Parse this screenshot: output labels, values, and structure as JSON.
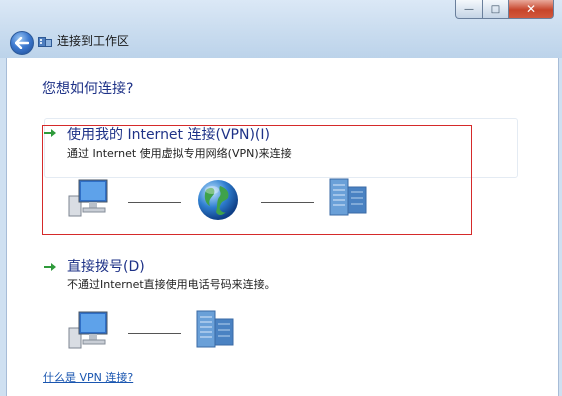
{
  "header": {
    "title": "连接到工作区",
    "minimize_label": "—",
    "maximize_label": "□",
    "close_label": "✕"
  },
  "main": {
    "question": "您想如何连接?",
    "options": [
      {
        "title": "使用我的 Internet 连接(VPN)(I)",
        "description": "通过 Internet 使用虚拟专用网络(VPN)来连接"
      },
      {
        "title": "直接拨号(D)",
        "description": "不通过Internet直接使用电话号码来连接。"
      }
    ],
    "help_link": "什么是 VPN 连接?"
  },
  "colors": {
    "heading": "#1e3287",
    "link": "#1a56b0",
    "highlight_border": "#d52a2a",
    "arrow": "#2e9a3a"
  },
  "icons": {
    "back": "back-arrow-icon",
    "wizard": "workplace-icon",
    "option_arrow": "green-arrow-icon",
    "computer": "computer-icon",
    "globe": "globe-icon",
    "server": "server-icon"
  }
}
